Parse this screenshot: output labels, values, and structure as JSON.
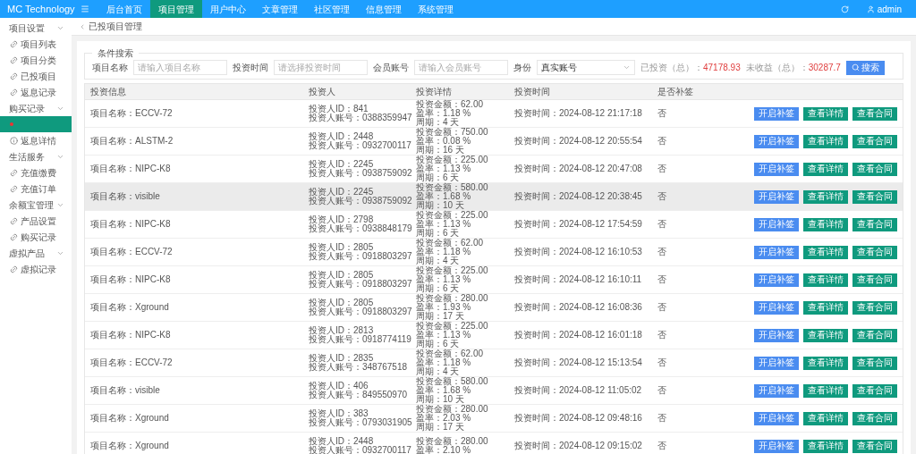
{
  "topbar": {
    "brand": "MC Technology",
    "nav": [
      {
        "label": "后台首页",
        "selected": false
      },
      {
        "label": "项目管理",
        "selected": true
      },
      {
        "label": "用户中心",
        "selected": false
      },
      {
        "label": "文章管理",
        "selected": false
      },
      {
        "label": "社区管理",
        "selected": false
      },
      {
        "label": "信息管理",
        "selected": false
      },
      {
        "label": "系统管理",
        "selected": false
      }
    ],
    "user": "admin"
  },
  "sidebar": [
    {
      "label": "项目设置",
      "expanded": true,
      "items": [
        {
          "label": "项目列表",
          "kind": "link",
          "selected": false
        },
        {
          "label": "项目分类",
          "kind": "link",
          "selected": false
        },
        {
          "label": "已投项目",
          "kind": "link",
          "selected": false
        },
        {
          "label": "返息记录",
          "kind": "link",
          "selected": false
        }
      ]
    },
    {
      "label": "购买记录",
      "expanded": true,
      "items": [
        {
          "kind": "dot",
          "selected": true
        },
        {
          "label": "返息详情",
          "kind": "info",
          "selected": false
        }
      ]
    },
    {
      "label": "生活服务",
      "expanded": true,
      "items": [
        {
          "label": "充值缴费",
          "kind": "link",
          "selected": false
        },
        {
          "label": "充值订单",
          "kind": "link",
          "selected": false
        }
      ]
    },
    {
      "label": "余额宝管理",
      "expanded": true,
      "items": [
        {
          "label": "产品设置",
          "kind": "link",
          "selected": false
        },
        {
          "label": "购买记录",
          "kind": "link",
          "selected": false
        }
      ]
    },
    {
      "label": "虚拟产品",
      "expanded": true,
      "items": [
        {
          "label": "虚拟记录",
          "kind": "link",
          "selected": false
        }
      ]
    }
  ],
  "breadcrumb": "已投项目管理",
  "search": {
    "legend": "条件搜索",
    "fields": [
      {
        "label": "项目名称",
        "placeholder": "请输入项目名称"
      },
      {
        "label": "投资时间",
        "placeholder": "请选择投资时间"
      },
      {
        "label": "会员账号",
        "placeholder": "请输入会员账号"
      }
    ],
    "identity": {
      "label": "身份",
      "value": "真实账号"
    },
    "totals": [
      {
        "label": "已投资（总）：",
        "value": "47178.93"
      },
      {
        "label": "未收益（总）：",
        "value": "30287.7"
      }
    ],
    "button": "搜索"
  },
  "table": {
    "columns": [
      "投资信息",
      "投资人",
      "投资详情",
      "投资时间",
      "是否补签"
    ],
    "rows": [
      {
        "project": "项目名称：ECCV-72",
        "investor": [
          "投资人ID：841",
          "投资人账号：0388359947"
        ],
        "details": [
          "投资金额：62.00",
          "盈率：1.18 %",
          "周期：4 天"
        ],
        "time": "投资时间：2024-08-12 21:17:18",
        "resign": "否",
        "highlighted": false,
        "actions": [
          {
            "label": "开启补签",
            "kind": "primary"
          },
          {
            "label": "查看详情",
            "kind": "success"
          },
          {
            "label": "查看合同",
            "kind": "success"
          }
        ]
      },
      {
        "project": "项目名称：ALSTM-2",
        "investor": [
          "投资人ID：2448",
          "投资人账号：0932700117"
        ],
        "details": [
          "投资金额：750.00",
          "盈率：0.08 %",
          "周期：16 天"
        ],
        "time": "投资时间：2024-08-12 20:55:54",
        "resign": "否",
        "highlighted": false,
        "actions": [
          {
            "label": "开启补签",
            "kind": "primary"
          },
          {
            "label": "查看详情",
            "kind": "success"
          },
          {
            "label": "查看合同",
            "kind": "success"
          }
        ]
      },
      {
        "project": "项目名称：NIPC-K8",
        "investor": [
          "投资人ID：2245",
          "投资人账号：0938759092"
        ],
        "details": [
          "投资金额：225.00",
          "盈率：1.13 %",
          "周期：6 天"
        ],
        "time": "投资时间：2024-08-12 20:47:08",
        "resign": "否",
        "highlighted": false,
        "actions": [
          {
            "label": "开启补签",
            "kind": "primary"
          },
          {
            "label": "查看详情",
            "kind": "success"
          },
          {
            "label": "查看合同",
            "kind": "success"
          }
        ]
      },
      {
        "project": "项目名称：visible",
        "investor": [
          "投资人ID：2245",
          "投资人账号：0938759092"
        ],
        "details": [
          "投资金额：580.00",
          "盈率：1.68 %",
          "周期：10 天"
        ],
        "time": "投资时间：2024-08-12 20:38:45",
        "resign": "否",
        "highlighted": true,
        "actions": [
          {
            "label": "开启补签",
            "kind": "primary"
          },
          {
            "label": "查看详情",
            "kind": "success"
          },
          {
            "label": "查看合同",
            "kind": "success"
          }
        ]
      },
      {
        "project": "项目名称：NIPC-K8",
        "investor": [
          "投资人ID：2798",
          "投资人账号：0938848179"
        ],
        "details": [
          "投资金额：225.00",
          "盈率：1.13 %",
          "周期：6 天"
        ],
        "time": "投资时间：2024-08-12 17:54:59",
        "resign": "否",
        "highlighted": false,
        "actions": [
          {
            "label": "开启补签",
            "kind": "primary"
          },
          {
            "label": "查看详情",
            "kind": "success"
          },
          {
            "label": "查看合同",
            "kind": "success"
          }
        ]
      },
      {
        "project": "项目名称：ECCV-72",
        "investor": [
          "投资人ID：2805",
          "投资人账号：0918803297"
        ],
        "details": [
          "投资金额：62.00",
          "盈率：1.18 %",
          "周期：4 天"
        ],
        "time": "投资时间：2024-08-12 16:10:53",
        "resign": "否",
        "highlighted": false,
        "actions": [
          {
            "label": "开启补签",
            "kind": "primary"
          },
          {
            "label": "查看详情",
            "kind": "success"
          },
          {
            "label": "查看合同",
            "kind": "success"
          }
        ]
      },
      {
        "project": "项目名称：NIPC-K8",
        "investor": [
          "投资人ID：2805",
          "投资人账号：0918803297"
        ],
        "details": [
          "投资金额：225.00",
          "盈率：1.13 %",
          "周期：6 天"
        ],
        "time": "投资时间：2024-08-12 16:10:11",
        "resign": "否",
        "highlighted": false,
        "actions": [
          {
            "label": "开启补签",
            "kind": "primary"
          },
          {
            "label": "查看详情",
            "kind": "success"
          },
          {
            "label": "查看合同",
            "kind": "success"
          }
        ]
      },
      {
        "project": "项目名称：Xground",
        "investor": [
          "投资人ID：2805",
          "投资人账号：0918803297"
        ],
        "details": [
          "投资金额：280.00",
          "盈率：1.93 %",
          "周期：17 天"
        ],
        "time": "投资时间：2024-08-12 16:08:36",
        "resign": "否",
        "highlighted": false,
        "actions": [
          {
            "label": "开启补签",
            "kind": "primary"
          },
          {
            "label": "查看详情",
            "kind": "success"
          },
          {
            "label": "查看合同",
            "kind": "success"
          }
        ]
      },
      {
        "project": "项目名称：NIPC-K8",
        "investor": [
          "投资人ID：2813",
          "投资人账号：0918774119"
        ],
        "details": [
          "投资金额：225.00",
          "盈率：1.13 %",
          "周期：6 天"
        ],
        "time": "投资时间：2024-08-12 16:01:18",
        "resign": "否",
        "highlighted": false,
        "actions": [
          {
            "label": "开启补签",
            "kind": "primary"
          },
          {
            "label": "查看详情",
            "kind": "success"
          },
          {
            "label": "查看合同",
            "kind": "success"
          }
        ]
      },
      {
        "project": "项目名称：ECCV-72",
        "investor": [
          "投资人ID：2835",
          "投资人账号：348767518"
        ],
        "details": [
          "投资金额：62.00",
          "盈率：1.18 %",
          "周期：4 天"
        ],
        "time": "投资时间：2024-08-12 15:13:54",
        "resign": "否",
        "highlighted": false,
        "actions": [
          {
            "label": "开启补签",
            "kind": "primary"
          },
          {
            "label": "查看详情",
            "kind": "success"
          },
          {
            "label": "查看合同",
            "kind": "success"
          }
        ]
      },
      {
        "project": "项目名称：visible",
        "investor": [
          "投资人ID：406",
          "投资人账号：849550970"
        ],
        "details": [
          "投资金额：580.00",
          "盈率：1.68 %",
          "周期：10 天"
        ],
        "time": "投资时间：2024-08-12 11:05:02",
        "resign": "否",
        "highlighted": false,
        "actions": [
          {
            "label": "开启补签",
            "kind": "primary"
          },
          {
            "label": "查看详情",
            "kind": "success"
          },
          {
            "label": "查看合同",
            "kind": "success"
          }
        ]
      },
      {
        "project": "项目名称：Xground",
        "investor": [
          "投资人ID：383",
          "投资人账号：0793031905"
        ],
        "details": [
          "投资金额：280.00",
          "盈率：2.03 %",
          "周期：17 天"
        ],
        "time": "投资时间：2024-08-12 09:48:16",
        "resign": "否",
        "highlighted": false,
        "actions": [
          {
            "label": "开启补签",
            "kind": "primary"
          },
          {
            "label": "查看详情",
            "kind": "success"
          },
          {
            "label": "查看合同",
            "kind": "success"
          }
        ]
      },
      {
        "project": "项目名称：Xground",
        "investor": [
          "投资人ID：2448",
          "投资人账号：0932700117"
        ],
        "details": [
          "投资金额：280.00",
          "盈率：2.10 %"
        ],
        "time": "投资时间：2024-08-12 09:15:02",
        "resign": "否",
        "highlighted": false,
        "actions": [
          {
            "label": "开启补签",
            "kind": "primary"
          },
          {
            "label": "查看详情",
            "kind": "success"
          },
          {
            "label": "查看合同",
            "kind": "success"
          }
        ]
      }
    ]
  }
}
